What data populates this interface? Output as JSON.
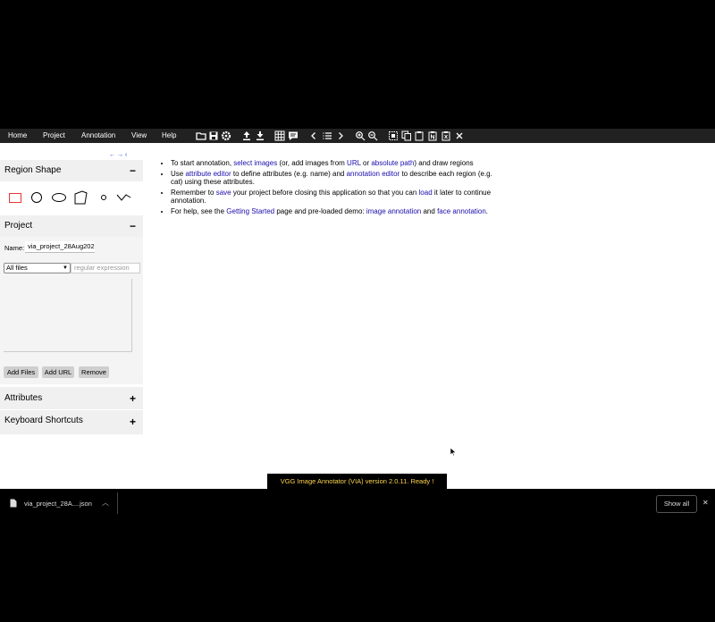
{
  "menu": {
    "home": "Home",
    "project": "Project",
    "annotation": "Annotation",
    "view": "View",
    "help": "Help"
  },
  "toolbar_icons": [
    "folder-icon",
    "save-icon",
    "gear-icon",
    "upload-icon",
    "download-icon",
    "grid-icon",
    "comment-icon",
    "prev-icon",
    "list-icon",
    "next-icon",
    "zoom-in-icon",
    "zoom-out-icon",
    "select-all-icon",
    "copy-icon",
    "paste-icon",
    "paste-n-icon",
    "delete-paste-icon",
    "close-icon"
  ],
  "nav_arrows": "← → ‹",
  "region_shape": {
    "title": "Region Shape",
    "toggle": "−"
  },
  "project": {
    "title": "Project",
    "toggle": "−",
    "name_label": "Name:",
    "name_value": "via_project_28Aug202",
    "filter_value": "All files",
    "regex_placeholder": "regular expression"
  },
  "buttons": {
    "add_files": "Add Files",
    "add_url": "Add URL",
    "remove": "Remove"
  },
  "attributes": {
    "title": "Attributes",
    "toggle": "+"
  },
  "shortcuts": {
    "title": "Keyboard Shortcuts",
    "toggle": "+"
  },
  "help": {
    "l1a": "To start annotation,",
    "l1link1": "select images",
    "l1b": "(or, add images from",
    "l1link2": "URL",
    "l1c": "or",
    "l1link3": "absolute path",
    "l1d": ") and draw regions",
    "l2a": "Use",
    "l2link1": "attribute editor",
    "l2b": "to define attributes (e.g. name) and",
    "l2link2": "annotation editor",
    "l2c": "to describe each region (e.g. cat) using these attributes.",
    "l3a": "Remember to",
    "l3link1": "save",
    "l3b": "your project before closing this application so that you can",
    "l3link2": "load",
    "l3c": "it later to continue annotation.",
    "l4a": "For help, see the",
    "l4link1": "Getting Started",
    "l4b": "page and pre-loaded demo:",
    "l4link2": "image annotation",
    "l4c": "and",
    "l4link3": "face annotation",
    "l4d": "."
  },
  "status": "VGG Image Annotator (VIA) version 2.0.11. Ready !",
  "download": {
    "filename": "via_project_28A....json",
    "show_all": "Show all",
    "close": "✕"
  }
}
